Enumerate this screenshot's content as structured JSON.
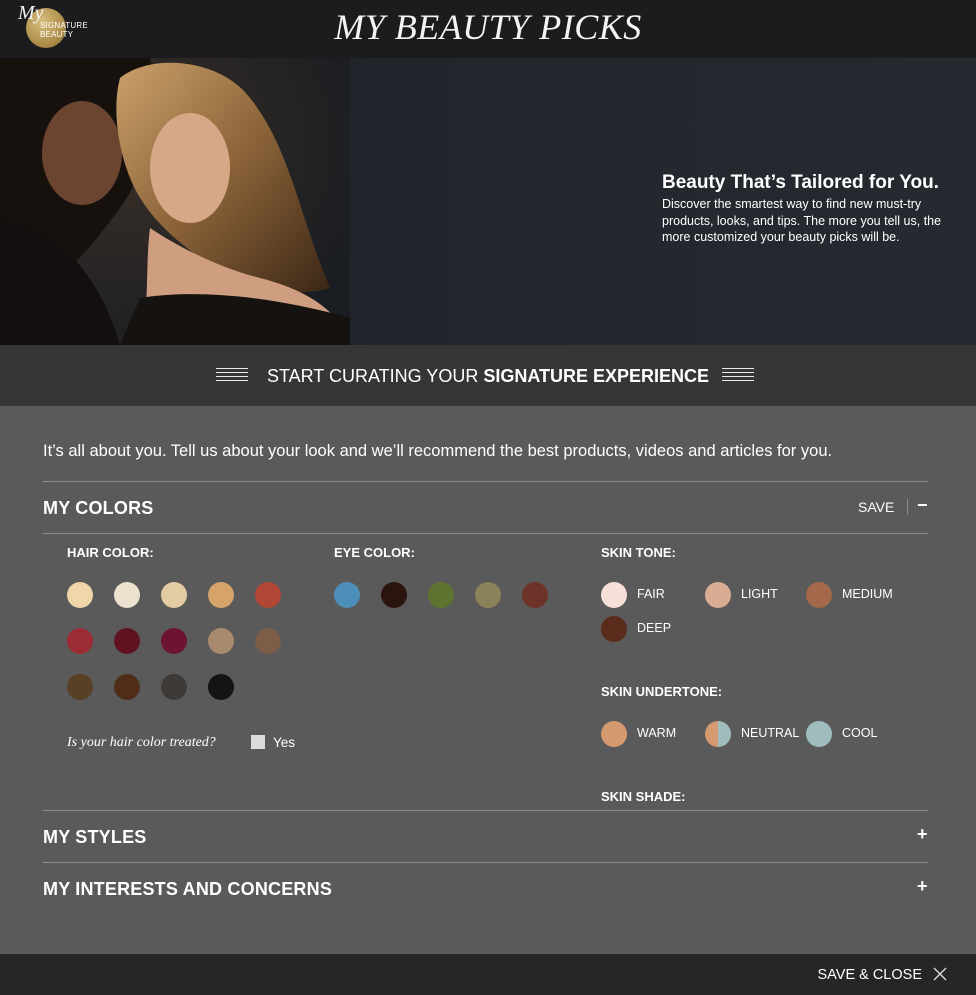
{
  "header": {
    "logo_my": "My",
    "logo_line1": "SIGNATURE",
    "logo_line2": "BEAUTY",
    "title": "MY BEAUTY PICKS"
  },
  "hero": {
    "heading": "Beauty That’s Tailored for You.",
    "text": "Discover the smartest way to find new must-try products, looks, and tips. The more you tell us, the more customized your beauty picks will be."
  },
  "banner": {
    "text_regular": "START CURATING YOUR ",
    "text_bold": "SIGNATURE EXPERIENCE"
  },
  "intro": "It’s all about you. Tell us about your look and we’ll recommend the best products, videos and articles for you.",
  "my_colors": {
    "title": "MY COLORS",
    "save_label": "SAVE",
    "toggle": "−",
    "hair_color_label": "HAIR COLOR:",
    "hair_colors": [
      "#f0d6a8",
      "#ece2cf",
      "#e3cba3",
      "#d6a46a",
      "#b24634",
      "#9c2c34",
      "#5f1220",
      "#6d1433",
      "#a88b6e",
      "#7c5d47",
      "#5a3f27",
      "#4f2d18",
      "#3e3a38",
      "#151414"
    ],
    "treated_question": "Is your hair color treated?",
    "treated_yes": "Yes",
    "eye_color_label": "EYE COLOR:",
    "eye_colors": [
      "#4d8fb8",
      "#2a140e",
      "#5f7331",
      "#8b8259",
      "#6e3328"
    ],
    "skin_tone_label": "SKIN TONE:",
    "skin_tones": [
      {
        "label": "FAIR",
        "color": "#f6e0d8"
      },
      {
        "label": "LIGHT",
        "color": "#d9ad93"
      },
      {
        "label": "MEDIUM",
        "color": "#a3694a"
      },
      {
        "label": "DEEP",
        "color": "#5a2c1c"
      }
    ],
    "skin_undertone_label": "SKIN UNDERTONE:",
    "skin_undertones": [
      {
        "label": "WARM",
        "color": "#d69a70"
      },
      {
        "label": "NEUTRAL",
        "color": "#d69a70",
        "color2": "#9fbdbd"
      },
      {
        "label": "COOL",
        "color": "#9fbdbd"
      }
    ],
    "skin_shade_label": "SKIN SHADE:"
  },
  "my_styles": {
    "title": "MY STYLES",
    "toggle": "+"
  },
  "my_interests": {
    "title": "MY INTERESTS AND CONCERNS",
    "toggle": "+"
  },
  "footer": {
    "save_close": "SAVE & CLOSE"
  }
}
